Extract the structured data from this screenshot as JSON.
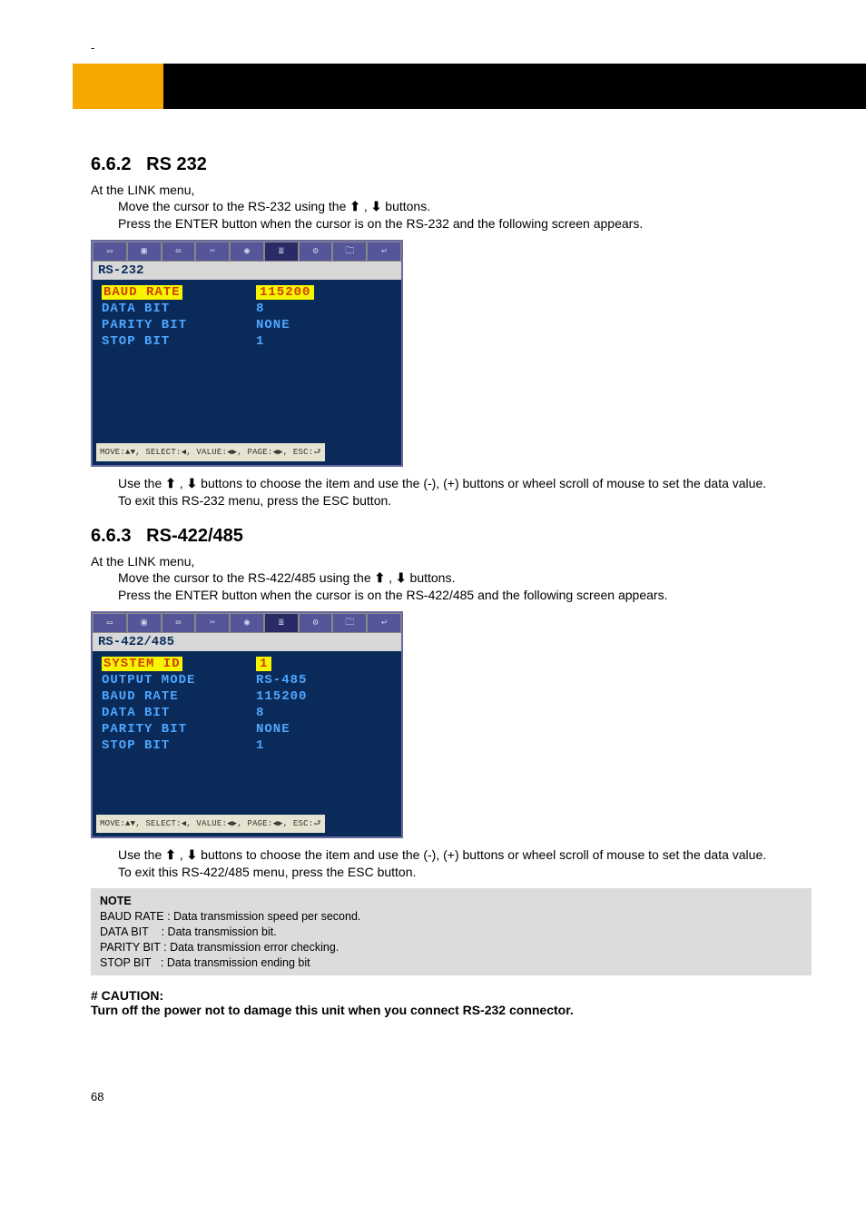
{
  "header": {
    "dash": "-"
  },
  "sections": {
    "rs232": {
      "num": "6.6.2",
      "title": "RS 232",
      "lead": "At the LINK menu,",
      "step1_a": "Move the cursor to the RS-232 using the ",
      "step1_b": " , ",
      "step1_c": " buttons.",
      "step2": "Press the ENTER button when the cursor is on the RS-232 and the following screen appears.",
      "after1_a": "Use the ",
      "after1_b": " , ",
      "after1_c": " buttons to choose the item and use the (-), (+) buttons or wheel scroll of mouse to set the data value.",
      "after2": "To exit this RS-232 menu, press the ESC button."
    },
    "rs422": {
      "num": "6.6.3",
      "title": "RS-422/485",
      "lead": "At the LINK menu,",
      "step1_a": "Move the cursor to the RS-422/485 using the ",
      "step1_b": " , ",
      "step1_c": " buttons.",
      "step2": "Press the ENTER button when the cursor is on the RS-422/485 and the following screen appears.",
      "after1_a": "Use the ",
      "after1_b": " , ",
      "after1_c": " buttons to choose the item and use the (-), (+) buttons or wheel scroll of mouse to set the data value.",
      "after2": "To exit this RS-422/485 menu, press the ESC button."
    }
  },
  "osd1": {
    "title": "RS-232",
    "rows": {
      "r0": {
        "label": "BAUD RATE",
        "val": "115200"
      },
      "r1": {
        "label": "DATA BIT",
        "val": "8"
      },
      "r2": {
        "label": "PARITY BIT",
        "val": "NONE"
      },
      "r3": {
        "label": "STOP BIT",
        "val": "1"
      }
    },
    "status": "MOVE:▲▼, SELECT:◀, VALUE:◀▶, PAGE:◀▶, ESC:⮐"
  },
  "osd2": {
    "title": "RS-422/485",
    "rows": {
      "r0": {
        "label": "SYSTEM ID",
        "val": "1"
      },
      "r1": {
        "label": "OUTPUT MODE",
        "val": "RS-485"
      },
      "r2": {
        "label": "BAUD RATE",
        "val": "115200"
      },
      "r3": {
        "label": "DATA BIT",
        "val": "8"
      },
      "r4": {
        "label": "PARITY BIT",
        "val": "NONE"
      },
      "r5": {
        "label": "STOP BIT",
        "val": "1"
      }
    },
    "status": "MOVE:▲▼, SELECT:◀, VALUE:◀▶, PAGE:◀▶, ESC:⮐"
  },
  "note": {
    "title": "NOTE",
    "l1": "BAUD RATE : Data transmission speed per second.",
    "l2": "DATA BIT    : Data transmission bit.",
    "l3": "PARITY BIT : Data transmission error checking.",
    "l4": "STOP BIT   : Data transmission ending bit"
  },
  "caution": {
    "title": "# CAUTION:",
    "text": "Turn off the power not to damage this unit when you connect RS-232 connector."
  },
  "glyphs": {
    "up": "⬆",
    "down": "⬇"
  },
  "pageNum": "68"
}
